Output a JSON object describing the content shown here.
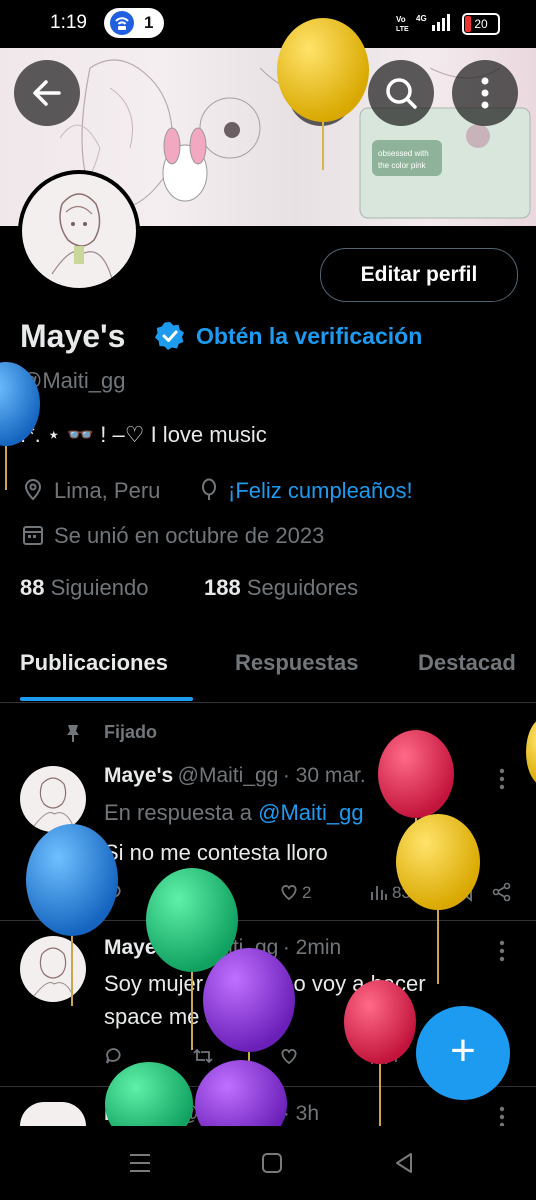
{
  "status_bar": {
    "time": "1:19",
    "notif_count": "1",
    "network": "Vo LTE 4G",
    "battery": "20"
  },
  "header": {
    "back_icon": "arrow-left-icon",
    "extra_icon": "circle-slash-icon",
    "search_icon": "search-icon",
    "more_icon": "more-vertical-icon"
  },
  "profile": {
    "name": "Maye's",
    "verify_cta": "Obtén la verificación",
    "handle": "@Maiti_gg",
    "bio": ".*. ⋆ 👓 !     –♡  I love music",
    "location": "Lima, Peru",
    "birthday": "¡Feliz cumpleaños!",
    "joined": "Se unió en octubre de 2023",
    "following_count": "88",
    "following_label": "Siguiendo",
    "followers_count": "188",
    "followers_label": "Seguidores",
    "edit_button": "Editar perfil"
  },
  "tabs": [
    "Publicaciones",
    "Respuestas",
    "Destacad"
  ],
  "pinned_label": "Fijado",
  "posts": [
    {
      "name": "Maye's",
      "handle": "@Maiti_gg",
      "time": "· 30 mar.",
      "reply_prefix": "En respuesta a",
      "reply_to": "@Maiti_gg",
      "text": "Si no me contesta lloro",
      "likes": "2",
      "views": "838"
    },
    {
      "name": "Maye's",
      "handle": "@Maiti_gg",
      "time": "· 2min",
      "text_line1": "Soy mujer miento no voy a hacer",
      "text_line2": "space me dormí",
      "views": "7"
    },
    {
      "name": "Maye's",
      "handle": "@Maiti_gg",
      "time": "· 3h"
    }
  ],
  "fab_label": "+",
  "colors": {
    "accent": "#1d9bf0",
    "background": "#000000",
    "muted": "#71767b"
  }
}
